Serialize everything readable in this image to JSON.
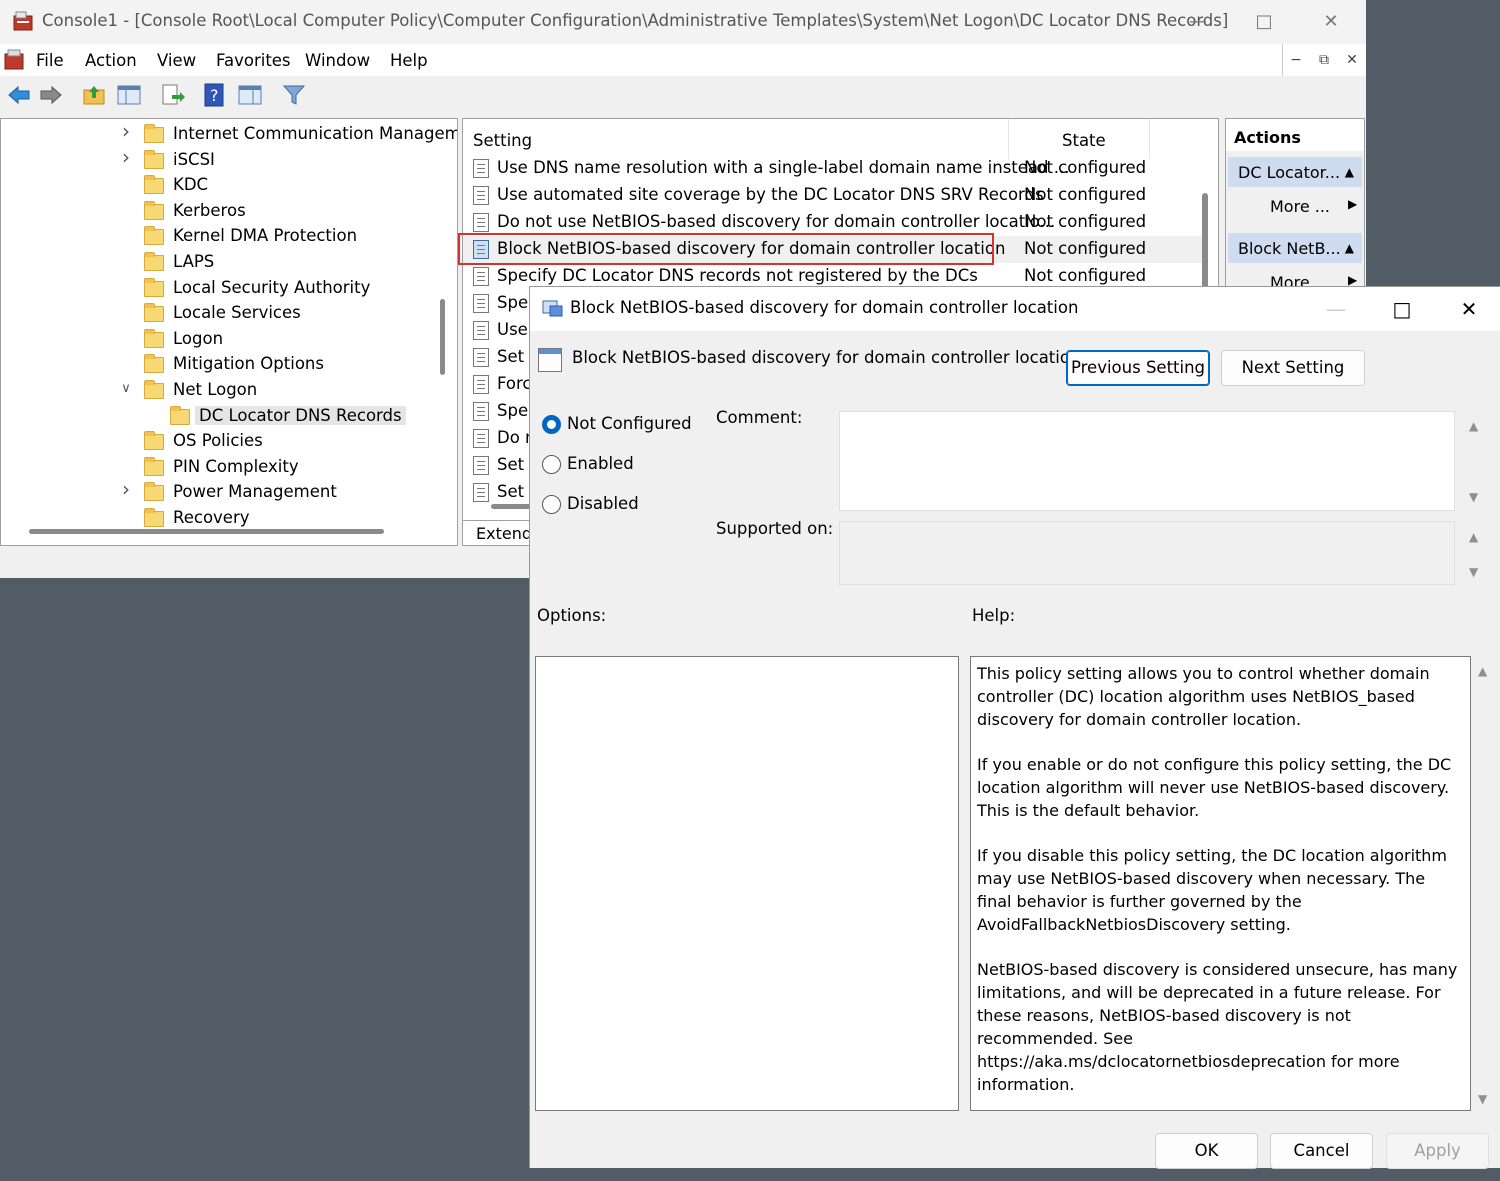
{
  "mmc": {
    "title": "Console1 - [Console Root\\Local Computer Policy\\Computer Configuration\\Administrative Templates\\System\\Net Logon\\DC Locator DNS Records]",
    "menu": [
      "File",
      "Action",
      "View",
      "Favorites",
      "Window",
      "Help"
    ],
    "tree": [
      {
        "label": "Internet Communication Managem",
        "expandable": true
      },
      {
        "label": "iSCSI",
        "expandable": true
      },
      {
        "label": "KDC"
      },
      {
        "label": "Kerberos"
      },
      {
        "label": "Kernel DMA Protection"
      },
      {
        "label": "LAPS"
      },
      {
        "label": "Local Security Authority"
      },
      {
        "label": "Locale Services"
      },
      {
        "label": "Logon"
      },
      {
        "label": "Mitigation Options"
      },
      {
        "label": "Net Logon",
        "expanded": true
      },
      {
        "label": "DC Locator DNS Records",
        "selected": true,
        "child": true
      },
      {
        "label": "OS Policies"
      },
      {
        "label": "PIN Complexity"
      },
      {
        "label": "Power Management",
        "expandable": true
      },
      {
        "label": "Recovery"
      }
    ],
    "list": {
      "col_setting": "Setting",
      "col_state": "State",
      "rows": [
        {
          "name": "Use DNS name resolution with a single-label domain name instead ...",
          "state": "Not configured"
        },
        {
          "name": "Use automated site coverage by the DC Locator DNS SRV Records",
          "state": "Not configured"
        },
        {
          "name": "Do not use NetBIOS-based discovery for domain controller locatio...",
          "state": "Not configured"
        },
        {
          "name": "Block NetBIOS-based discovery for domain controller location",
          "state": "Not configured",
          "highlight": true
        },
        {
          "name": "Specify DC Locator DNS records not registered by the DCs",
          "state": "Not configured"
        },
        {
          "name": "Spec",
          "state": ""
        },
        {
          "name": "Use",
          "state": ""
        },
        {
          "name": "Set T",
          "state": ""
        },
        {
          "name": "Forc",
          "state": ""
        },
        {
          "name": "Spec",
          "state": ""
        },
        {
          "name": "Do n",
          "state": ""
        },
        {
          "name": "Set F",
          "state": ""
        },
        {
          "name": "Set V",
          "state": ""
        }
      ],
      "tab": "Extende"
    },
    "actions": {
      "header": "Actions",
      "group1": "DC Locator...",
      "more1": "More ...",
      "group2": "Block NetB...",
      "more2": "More ..."
    }
  },
  "dialog": {
    "title": "Block NetBIOS-based discovery for domain controller location",
    "heading": "Block NetBIOS-based discovery for domain controller location",
    "prev_button": "Previous Setting",
    "next_button": "Next Setting",
    "radios": [
      {
        "label": "Not Configured",
        "checked": true
      },
      {
        "label": "Enabled",
        "checked": false
      },
      {
        "label": "Disabled",
        "checked": false
      }
    ],
    "comment_label": "Comment:",
    "supported_label": "Supported on:",
    "options_label": "Options:",
    "help_label": "Help:",
    "help_paragraphs": [
      "This policy setting allows you to control whether domain controller (DC) location algorithm uses NetBIOS_based discovery for domain controller location.",
      "If you enable or do not configure this policy setting, the DC location algorithm will never use NetBIOS-based discovery. This is the default behavior.",
      "If you disable this policy setting, the DC location algorithm may use NetBIOS-based discovery when necessary. The final behavior is further governed by the AvoidFallbackNetbiosDiscovery setting.",
      "NetBIOS-based discovery is considered unsecure, has many limitations, and will be deprecated in a future release. For these reasons, NetBIOS-based discovery is not recommended. See https://aka.ms/dclocatornetbiosdeprecation for more information."
    ],
    "ok": "OK",
    "cancel": "Cancel",
    "apply": "Apply"
  },
  "colors": {
    "accent": "#0067c0",
    "highlight_border": "#d0342c",
    "desktop": "#525c66"
  }
}
